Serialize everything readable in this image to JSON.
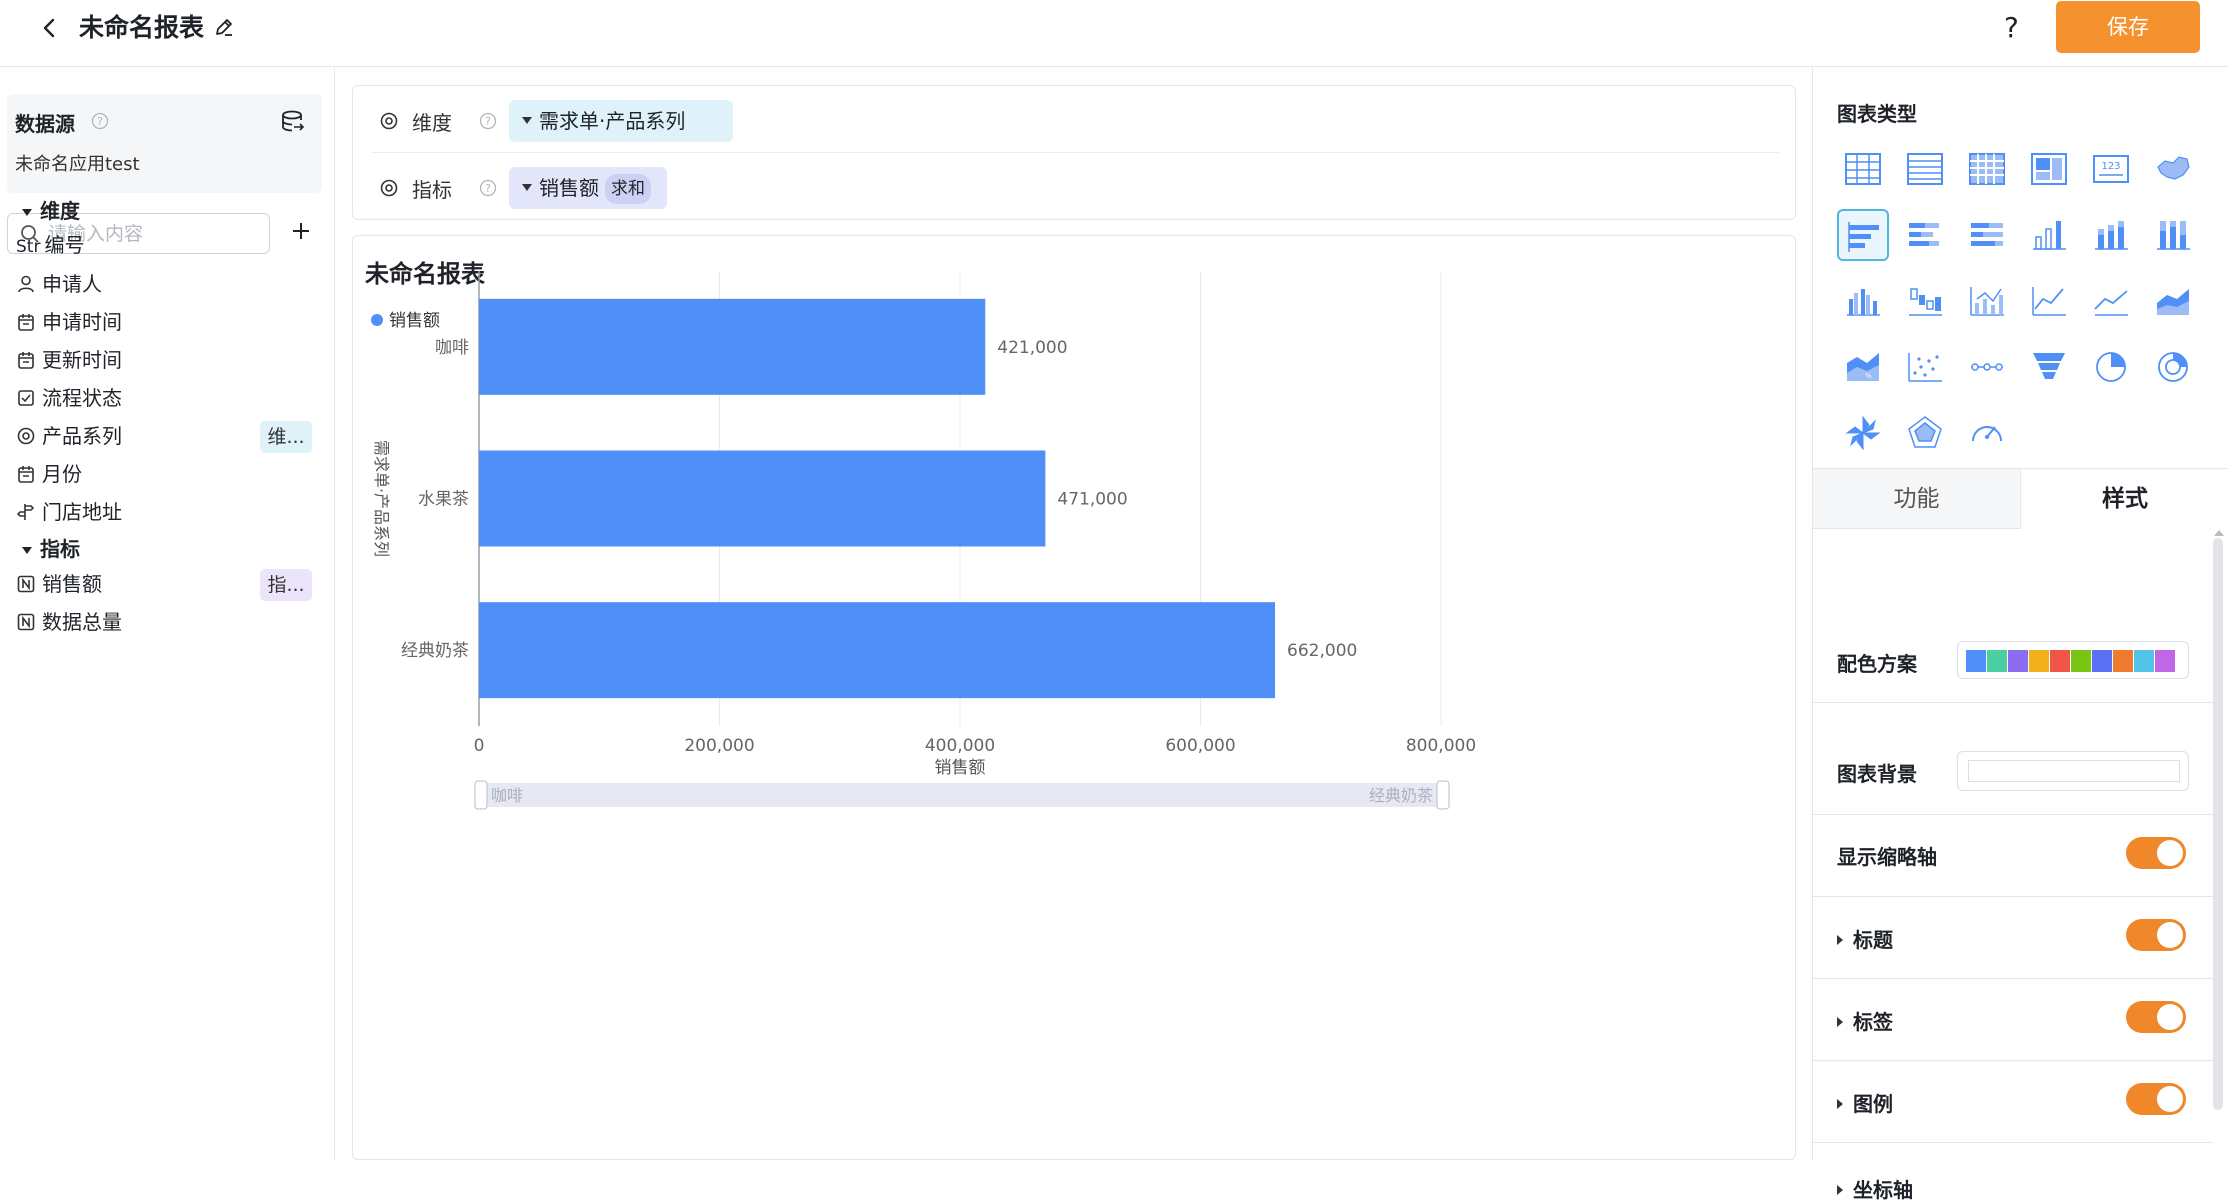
{
  "header": {
    "title": "未命名报表",
    "help": "?",
    "save_label": "保存"
  },
  "left": {
    "datasource_title": "数据源",
    "datasource_name": "未命名应用test",
    "search_placeholder": "请输入内容",
    "dimension_section": "维度",
    "measure_section": "指标",
    "dimensions": [
      {
        "label": "编号",
        "icon": "str-icon",
        "prefix": "Str"
      },
      {
        "label": "申请人",
        "icon": "user-icon"
      },
      {
        "label": "申请时间",
        "icon": "calendar-icon"
      },
      {
        "label": "更新时间",
        "icon": "calendar-icon"
      },
      {
        "label": "流程状态",
        "icon": "checkbox-icon"
      },
      {
        "label": "产品系列",
        "icon": "radio-icon",
        "chip": "维..."
      },
      {
        "label": "月份",
        "icon": "calendar-icon"
      },
      {
        "label": "门店地址",
        "icon": "location-icon"
      }
    ],
    "measures": [
      {
        "label": "销售额",
        "icon": "number-icon",
        "chip": "指..."
      },
      {
        "label": "数据总量",
        "icon": "number-icon"
      }
    ]
  },
  "config": {
    "dimension_label": "维度",
    "dimension_value": "需求单·产品系列",
    "measure_label": "指标",
    "measure_value": "销售额",
    "measure_agg": "求和"
  },
  "chart_title": "未命名报表",
  "chart_data": {
    "type": "bar",
    "orientation": "horizontal",
    "categories": [
      "咖啡",
      "水果茶",
      "经典奶茶"
    ],
    "series": [
      {
        "name": "销售额",
        "values": [
          421000,
          471000,
          662000
        ],
        "color": "#4f8ff7"
      }
    ],
    "value_labels": [
      "421,000",
      "471,000",
      "662,000"
    ],
    "xlabel": "销售额",
    "ylabel": "需求单·产品系列",
    "xlim": [
      0,
      800000
    ],
    "xticks": [
      "0",
      "200,000",
      "400,000",
      "600,000",
      "800,000"
    ],
    "grid": true,
    "legend": "top-left",
    "slider_start": "咖啡",
    "slider_end": "经典奶茶"
  },
  "right": {
    "chart_type_title": "图表类型",
    "tab_function": "功能",
    "tab_style": "样式",
    "color_scheme_label": "配色方案",
    "palette": [
      "#4f8ff7",
      "#4ccfa0",
      "#8b6cf0",
      "#f2b11a",
      "#f0554a",
      "#7ac414",
      "#5970f2",
      "#f07a2e",
      "#52c4e8",
      "#c266e8"
    ],
    "background_label": "图表背景",
    "thumbnail_axis_label": "显示缩略轴",
    "title_label": "标题",
    "tag_label": "标签",
    "legend_label": "图例",
    "axis_label": "坐标轴"
  }
}
